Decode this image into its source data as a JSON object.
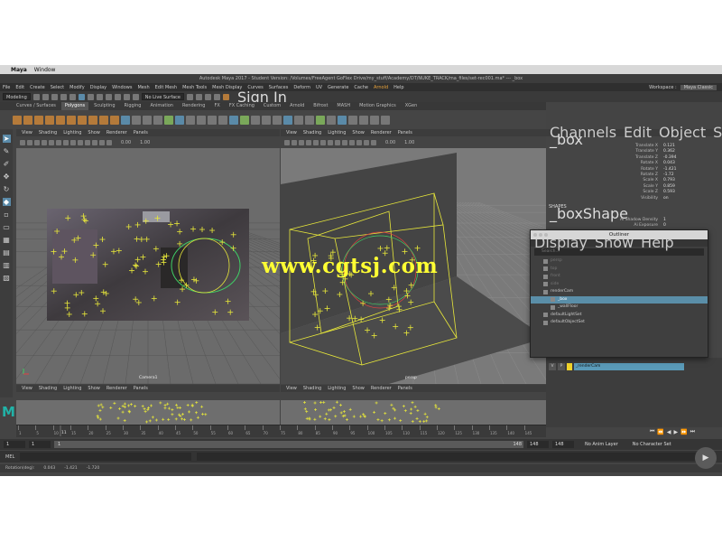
{
  "mac_menu": {
    "apple": "",
    "app": "Maya",
    "window": "Window"
  },
  "window_title": "Autodesk Maya 2017 - Student Version: /Volumes/FreeAgent GoFlex Drive/my_stuff/Academy/DT/NUKE_TRACK/ma_files/set-rec001.ma* --- _box",
  "main_menu": [
    "File",
    "Edit",
    "Create",
    "Select",
    "Modify",
    "Display",
    "Windows",
    "Mesh",
    "Edit Mesh",
    "Mesh Tools",
    "Mesh Display",
    "Curves",
    "Surfaces",
    "Deform",
    "UV",
    "Generate",
    "Cache",
    "Arnold",
    "Help"
  ],
  "workspace": {
    "label": "Workspace :",
    "value": "Maya Classic"
  },
  "status_line": {
    "mode": "Modeling",
    "live_surface": "No Live Surface",
    "sign_in": "Sign In"
  },
  "shelf_tabs": [
    "Curves / Surfaces",
    "Polygons",
    "Sculpting",
    "Rigging",
    "Animation",
    "Rendering",
    "FX",
    "FX Caching",
    "Custom",
    "Arnold",
    "Bifrost",
    "MASH",
    "Motion Graphics",
    "XGen"
  ],
  "active_shelf": "Polygons",
  "viewport_menu": [
    "View",
    "Shading",
    "Lighting",
    "Show",
    "Renderer",
    "Panels"
  ],
  "viewport_left": {
    "camera_label": "Camera1",
    "counter": "0.00",
    "scale": "1.00"
  },
  "viewport_right": {
    "camera_label": "persp",
    "counter": "0.00",
    "scale": "1.00"
  },
  "bottom_left_vp": {
    "label": "Front"
  },
  "bottom_right_vp": {
    "label": "Side"
  },
  "channel_box": {
    "menu": [
      "Channels",
      "Edit",
      "Object",
      "Show"
    ],
    "node": "_box",
    "attributes": [
      {
        "label": "Translate X",
        "value": "0.121"
      },
      {
        "label": "Translate Y",
        "value": "0.362"
      },
      {
        "label": "Translate Z",
        "value": "-0.394"
      },
      {
        "label": "Rotate X",
        "value": "0.043"
      },
      {
        "label": "Rotate Y",
        "value": "-1.421"
      },
      {
        "label": "Rotate Z",
        "value": "-1.72"
      },
      {
        "label": "Scale X",
        "value": "0.793"
      },
      {
        "label": "Scale Y",
        "value": "0.859"
      },
      {
        "label": "Scale Z",
        "value": "0.593"
      },
      {
        "label": "Visibility",
        "value": "on"
      }
    ],
    "shapes_header": "SHAPES",
    "shape_node": "_boxShape",
    "shape_attributes": [
      {
        "label": "Ai Shadow Density",
        "value": "1"
      },
      {
        "label": "Ai Exposure",
        "value": "0"
      }
    ]
  },
  "outliner": {
    "title": "Outliner",
    "menu": [
      "Display",
      "Show",
      "Help"
    ],
    "search_placeholder": "Search...",
    "items": [
      {
        "label": "persp",
        "dim": true,
        "child": false,
        "selected": false
      },
      {
        "label": "top",
        "dim": true,
        "child": false,
        "selected": false
      },
      {
        "label": "front",
        "dim": true,
        "child": false,
        "selected": false
      },
      {
        "label": "side",
        "dim": true,
        "child": false,
        "selected": false
      },
      {
        "label": "renderCam",
        "dim": false,
        "child": false,
        "selected": false
      },
      {
        "label": "_box",
        "dim": false,
        "child": true,
        "selected": true
      },
      {
        "label": "_wallFloor",
        "dim": false,
        "child": true,
        "selected": false
      },
      {
        "label": "defaultLightSet",
        "dim": false,
        "child": false,
        "selected": false
      },
      {
        "label": "defaultObjectSet",
        "dim": false,
        "child": false,
        "selected": false
      }
    ]
  },
  "layer": {
    "visibility": "V",
    "playback": "P",
    "name": "_renderCam",
    "color": "#f2d42a"
  },
  "timeline": {
    "ticks": [
      "1",
      "5",
      "10",
      "15",
      "20",
      "25",
      "30",
      "35",
      "40",
      "45",
      "50",
      "55",
      "60",
      "65",
      "70",
      "75",
      "80",
      "85",
      "90",
      "95",
      "100",
      "105",
      "110",
      "115",
      "120",
      "125",
      "130",
      "135",
      "140",
      "145"
    ],
    "current_frame": "11"
  },
  "range": {
    "start": "1",
    "start2": "1",
    "slider_start": "1",
    "slider_end": "148",
    "end": "148",
    "end2": "148",
    "anim_layer": "No Anim Layer",
    "character_set": "No Character Set"
  },
  "mel": {
    "label": "MEL"
  },
  "help_line": {
    "label": "Rotation(deg):",
    "x": "0.043",
    "y": "-1.421",
    "z": "-1.720"
  },
  "watermark": "www.cgtsj.com",
  "colors": {
    "selection": "#5a8ea8",
    "tracker": "#e8e83a",
    "wire": "#d9e36a",
    "maya_logo": "#21b2a7"
  }
}
